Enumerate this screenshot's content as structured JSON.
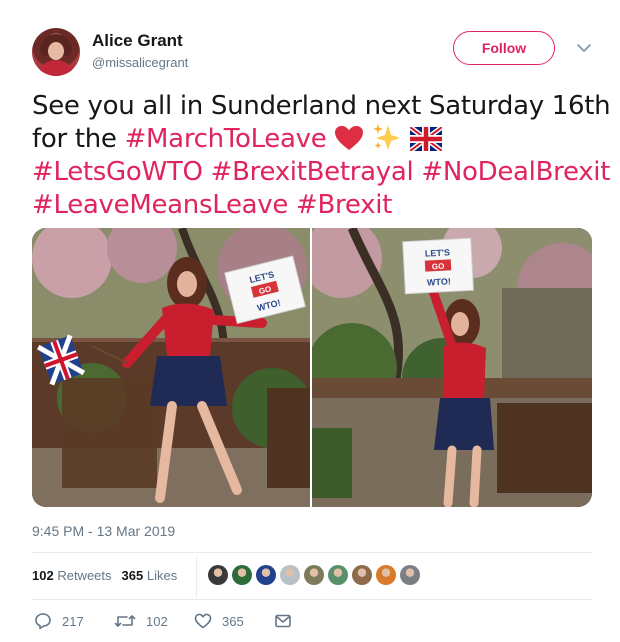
{
  "author": {
    "display_name": "Alice Grant",
    "handle": "@missalicegrant",
    "avatar_icon": "profile-avatar"
  },
  "follow_button": {
    "label": "Follow",
    "color": "#e0245e"
  },
  "tweet": {
    "lines": [
      [
        {
          "text": "See you all in Sunderland next Saturday 16th",
          "type": "text"
        }
      ],
      [
        {
          "text": "for the ",
          "type": "text"
        },
        {
          "text": "#MarchToLeave",
          "type": "hashtag"
        },
        {
          "text": " ",
          "type": "text"
        }
      ],
      [
        {
          "text": "#LetsGoWTO",
          "type": "hashtag"
        },
        {
          "text": " ",
          "type": "text"
        },
        {
          "text": "#BrexitBetrayal",
          "type": "hashtag"
        },
        {
          "text": " ",
          "type": "text"
        },
        {
          "text": "#NoDealBrexit",
          "type": "hashtag"
        }
      ],
      [
        {
          "text": "#LeaveMeansLeave",
          "type": "hashtag"
        },
        {
          "text": " ",
          "type": "text"
        },
        {
          "text": "#Brexit",
          "type": "hashtag"
        }
      ]
    ],
    "emojis": [
      "heart-emoji",
      "sparkles-emoji",
      "uk-flag-emoji"
    ]
  },
  "photos": {
    "left": {
      "sign_text": [
        "LET'S",
        "GO",
        "WTO!"
      ]
    },
    "right": {
      "sign_text": [
        "LET'S",
        "GO",
        "WTO!"
      ]
    }
  },
  "timestamp": "9:45 PM - 13 Mar 2019",
  "stats": {
    "retweets_count": "102",
    "retweets_label": "Retweets",
    "likes_count": "365",
    "likes_label": "Likes"
  },
  "likers": [
    {
      "color": "#3a3a3a"
    },
    {
      "color": "#2e6b3a"
    },
    {
      "color": "#23408e"
    },
    {
      "color": "#b8c0c8"
    },
    {
      "color": "#7d7a5a"
    },
    {
      "color": "#5a8f6b"
    },
    {
      "color": "#8c6a4a"
    },
    {
      "color": "#d87a2a"
    },
    {
      "color": "#7a7f86"
    }
  ],
  "actions": {
    "reply_count": "217",
    "retweet_count": "102",
    "like_count": "365"
  },
  "colors": {
    "accent": "#e0245e",
    "secondary_text": "#657786",
    "divider": "#e6ecf0"
  }
}
